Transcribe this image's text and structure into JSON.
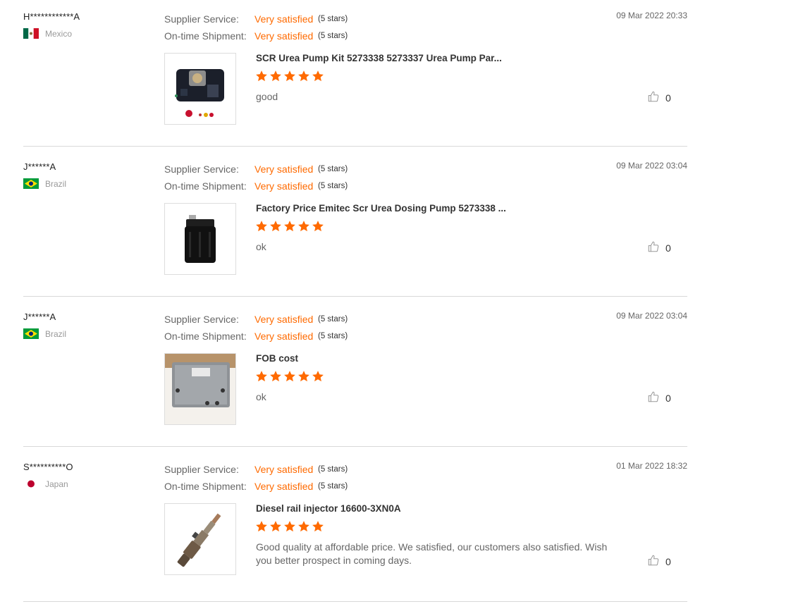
{
  "colors": {
    "accent": "#ff6a00",
    "divider": "#d9d9d9",
    "muted": "#999999"
  },
  "labels": {
    "supplier_service": "Supplier Service:",
    "ontime_shipment": "On-time Shipment:"
  },
  "reviews": [
    {
      "username": "H************A",
      "country": "Mexico",
      "flag_icon": "mexico-flag-icon",
      "date": "09 Mar 2022 20:33",
      "supplier_service": {
        "value": "Very satisfied",
        "stars": "(5 stars)"
      },
      "ontime_shipment": {
        "value": "Very satisfied",
        "stars": "(5 stars)"
      },
      "product_title": "SCR Urea Pump Kit 5273338 5273337 Urea Pump Par...",
      "product_rating": 5,
      "comment": "good",
      "likes": "0"
    },
    {
      "username": "J******A",
      "country": "Brazil",
      "flag_icon": "brazil-flag-icon",
      "date": "09 Mar 2022 03:04",
      "supplier_service": {
        "value": "Very satisfied",
        "stars": "(5 stars)"
      },
      "ontime_shipment": {
        "value": "Very satisfied",
        "stars": "(5 stars)"
      },
      "product_title": "Factory Price Emitec Scr Urea Dosing Pump 5273338 ...",
      "product_rating": 5,
      "comment": "ok",
      "likes": "0"
    },
    {
      "username": "J******A",
      "country": "Brazil",
      "flag_icon": "brazil-flag-icon",
      "date": "09 Mar 2022 03:04",
      "supplier_service": {
        "value": "Very satisfied",
        "stars": "(5 stars)"
      },
      "ontime_shipment": {
        "value": "Very satisfied",
        "stars": "(5 stars)"
      },
      "product_title": "FOB cost",
      "product_rating": 5,
      "comment": "ok",
      "likes": "0"
    },
    {
      "username": "S**********O",
      "country": "Japan",
      "flag_icon": "japan-flag-icon",
      "date": "01 Mar 2022 18:32",
      "supplier_service": {
        "value": "Very satisfied",
        "stars": "(5 stars)"
      },
      "ontime_shipment": {
        "value": "Very satisfied",
        "stars": "(5 stars)"
      },
      "product_title": "Diesel rail injector 16600-3XN0A",
      "product_rating": 5,
      "comment": "Good quality at affordable price. We satisfied, our customers also satisfied. Wish you better prospect in coming days.",
      "likes": "0"
    }
  ]
}
